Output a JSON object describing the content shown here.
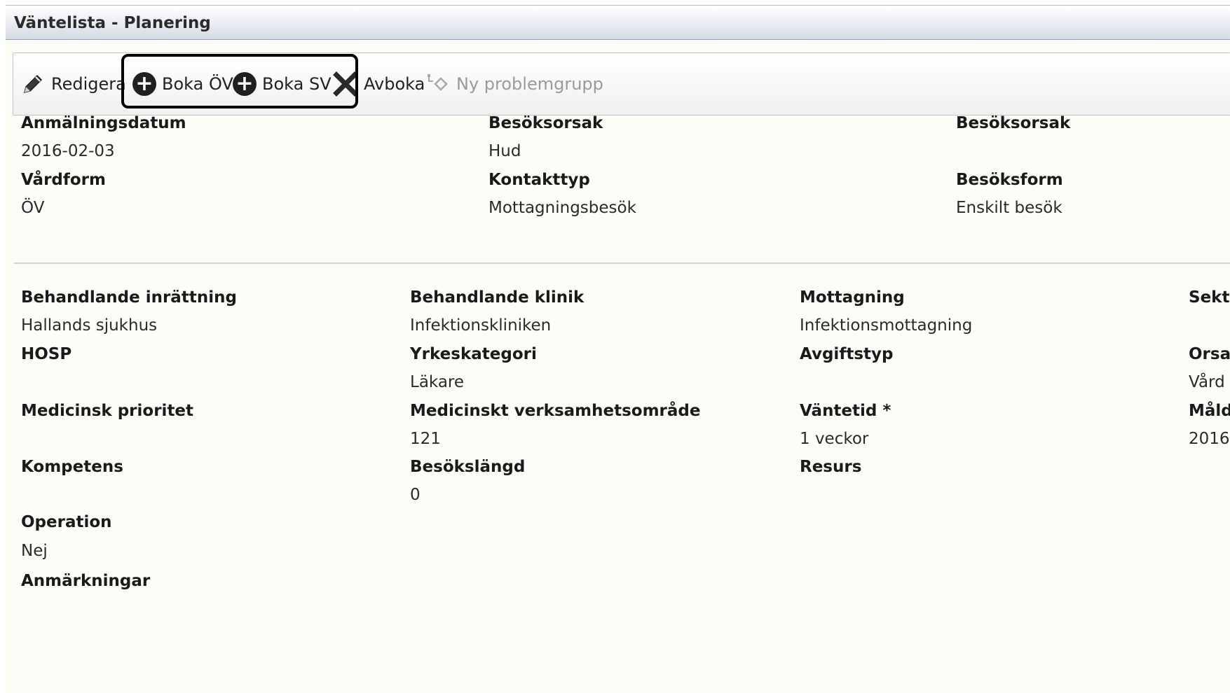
{
  "window": {
    "title": "Väntelista - Planering"
  },
  "toolbar": {
    "edit_label": "Redigera",
    "book_ov_label": "Boka ÖV",
    "book_sv_label": "Boka SV",
    "cancel_label": "Avboka",
    "new_problem_group_label": "Ny problemgrupp"
  },
  "summary": {
    "registration_date": {
      "label": "Anmälningsdatum",
      "value": "2016-02-03"
    },
    "visit_reason": {
      "label": "Besöksorsak",
      "value": "Hud"
    },
    "visit_reason_2": {
      "label": "Besöksorsak",
      "value": ""
    },
    "care_form": {
      "label": "Vårdform",
      "value": "ÖV"
    },
    "contact_type": {
      "label": "Kontakttyp",
      "value": "Mottagningsbesök"
    },
    "visit_form": {
      "label": "Besöksform",
      "value": "Enskilt besök"
    }
  },
  "details": {
    "treating_institution": {
      "label": "Behandlande inrättning",
      "value": "Hallands sjukhus"
    },
    "treating_clinic": {
      "label": "Behandlande klinik",
      "value": "Infektionskliniken"
    },
    "reception": {
      "label": "Mottagning",
      "value": "Infektionsmottagning"
    },
    "section": {
      "label": "Sekt",
      "value": ""
    },
    "hosp": {
      "label": "HOSP",
      "value": ""
    },
    "profession_category": {
      "label": "Yrkeskategori",
      "value": "Läkare"
    },
    "fee_type": {
      "label": "Avgiftstyp",
      "value": ""
    },
    "cause": {
      "label": "Orsa",
      "value": "Vård"
    },
    "medical_priority": {
      "label": "Medicinsk prioritet",
      "value": ""
    },
    "medical_area": {
      "label": "Medicinskt verksamhetsområde",
      "value": "121"
    },
    "waiting_time": {
      "label": "Väntetid *",
      "value": "1 veckor"
    },
    "target_date": {
      "label": "Måld",
      "value": "2016"
    },
    "competence": {
      "label": "Kompetens",
      "value": ""
    },
    "visit_length": {
      "label": "Besökslängd",
      "value": "0"
    },
    "resource": {
      "label": "Resurs",
      "value": ""
    },
    "operation": {
      "label": "Operation",
      "value": "Nej"
    },
    "remarks": {
      "label": "Anmärkningar",
      "value": ""
    }
  },
  "colors": {
    "highlight_border": "#000000",
    "disabled_text": "#9a9a9a"
  }
}
